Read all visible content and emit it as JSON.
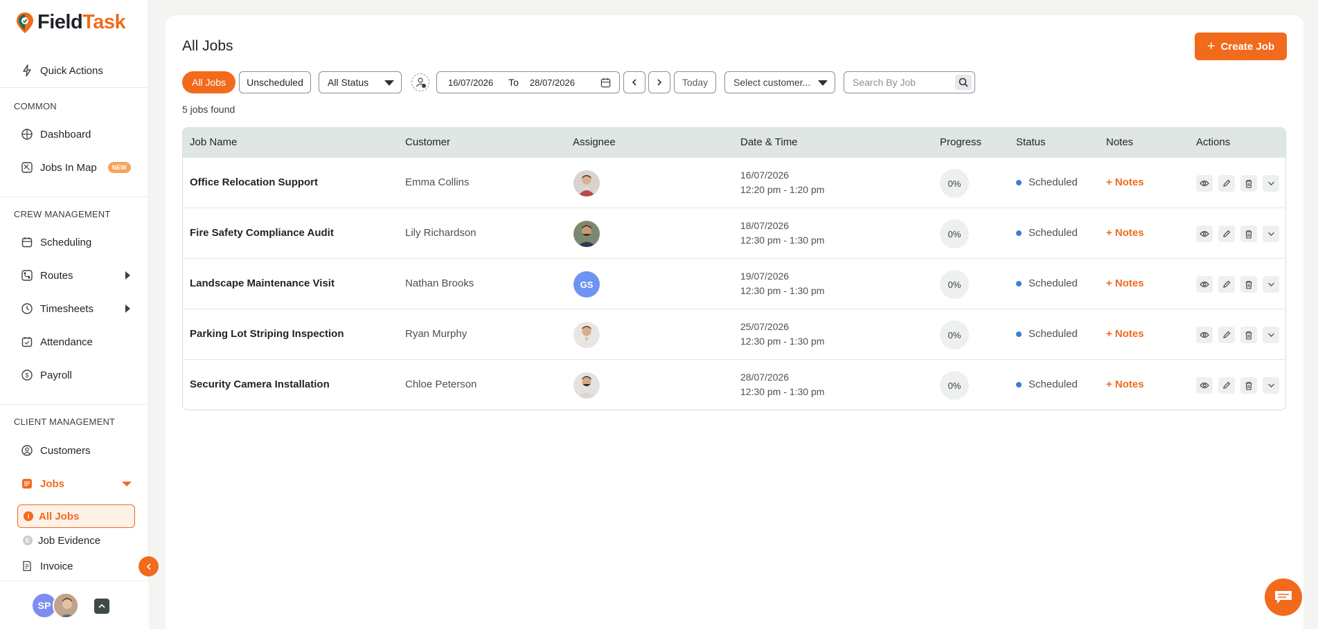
{
  "app": {
    "name_part1": "Field",
    "name_part2": "Task"
  },
  "sidebar": {
    "quick_actions": "Quick Actions",
    "section_common": "COMMON",
    "dashboard": "Dashboard",
    "jobs_in_map": "Jobs In Map",
    "new_badge": "NEW",
    "section_crew": "CREW MANAGEMENT",
    "scheduling": "Scheduling",
    "routes": "Routes",
    "timesheets": "Timesheets",
    "attendance": "Attendance",
    "payroll": "Payroll",
    "section_client": "CLIENT MANAGEMENT",
    "customers": "Customers",
    "jobs": "Jobs",
    "all_jobs": "All Jobs",
    "job_evidence": "Job Evidence",
    "invoice": "Invoice",
    "user_initials": "SP"
  },
  "main": {
    "title": "All Jobs",
    "create_button": "Create Job",
    "filters": {
      "all_jobs": "All Jobs",
      "unscheduled": "Unscheduled",
      "status_select": "All Status",
      "date_from": "16/07/2026",
      "date_to_label": "To",
      "date_to": "28/07/2026",
      "today": "Today",
      "customer_select": "Select customer...",
      "search_placeholder": "Search By Job"
    },
    "jobs_found": "5 jobs found"
  },
  "table": {
    "headers": {
      "job_name": "Job Name",
      "customer": "Customer",
      "assignee": "Assignee",
      "date_time": "Date & Time",
      "progress": "Progress",
      "status": "Status",
      "notes": "Notes",
      "actions": "Actions"
    },
    "rows": [
      {
        "job": "Office Relocation Support",
        "customer": "Emma Collins",
        "assignee": "photo",
        "date": "16/07/2026",
        "time": "12:20 pm - 1:20 pm",
        "progress": "0%",
        "status": "Scheduled",
        "notes": "+ Notes"
      },
      {
        "job": "Fire Safety Compliance Audit",
        "customer": "Lily Richardson",
        "assignee": "photo",
        "date": "18/07/2026",
        "time": "12:30 pm - 1:30 pm",
        "progress": "0%",
        "status": "Scheduled",
        "notes": "+ Notes"
      },
      {
        "job": "Landscape Maintenance Visit",
        "customer": "Nathan Brooks",
        "assignee": "GS",
        "date": "19/07/2026",
        "time": "12:30 pm - 1:30 pm",
        "progress": "0%",
        "status": "Scheduled",
        "notes": "+ Notes"
      },
      {
        "job": "Parking Lot Striping Inspection",
        "customer": "Ryan Murphy",
        "assignee": "photo",
        "date": "25/07/2026",
        "time": "12:30 pm - 1:30 pm",
        "progress": "0%",
        "status": "Scheduled",
        "notes": "+ Notes"
      },
      {
        "job": "Security Camera Installation",
        "customer": "Chloe Peterson",
        "assignee": "photo",
        "date": "28/07/2026",
        "time": "12:30 pm - 1:30 pm",
        "progress": "0%",
        "status": "Scheduled",
        "notes": "+ Notes"
      }
    ]
  },
  "colors": {
    "accent": "#f26a1b",
    "status_dot": "#3b7dd8",
    "header_bg": "#dfe6e4"
  }
}
